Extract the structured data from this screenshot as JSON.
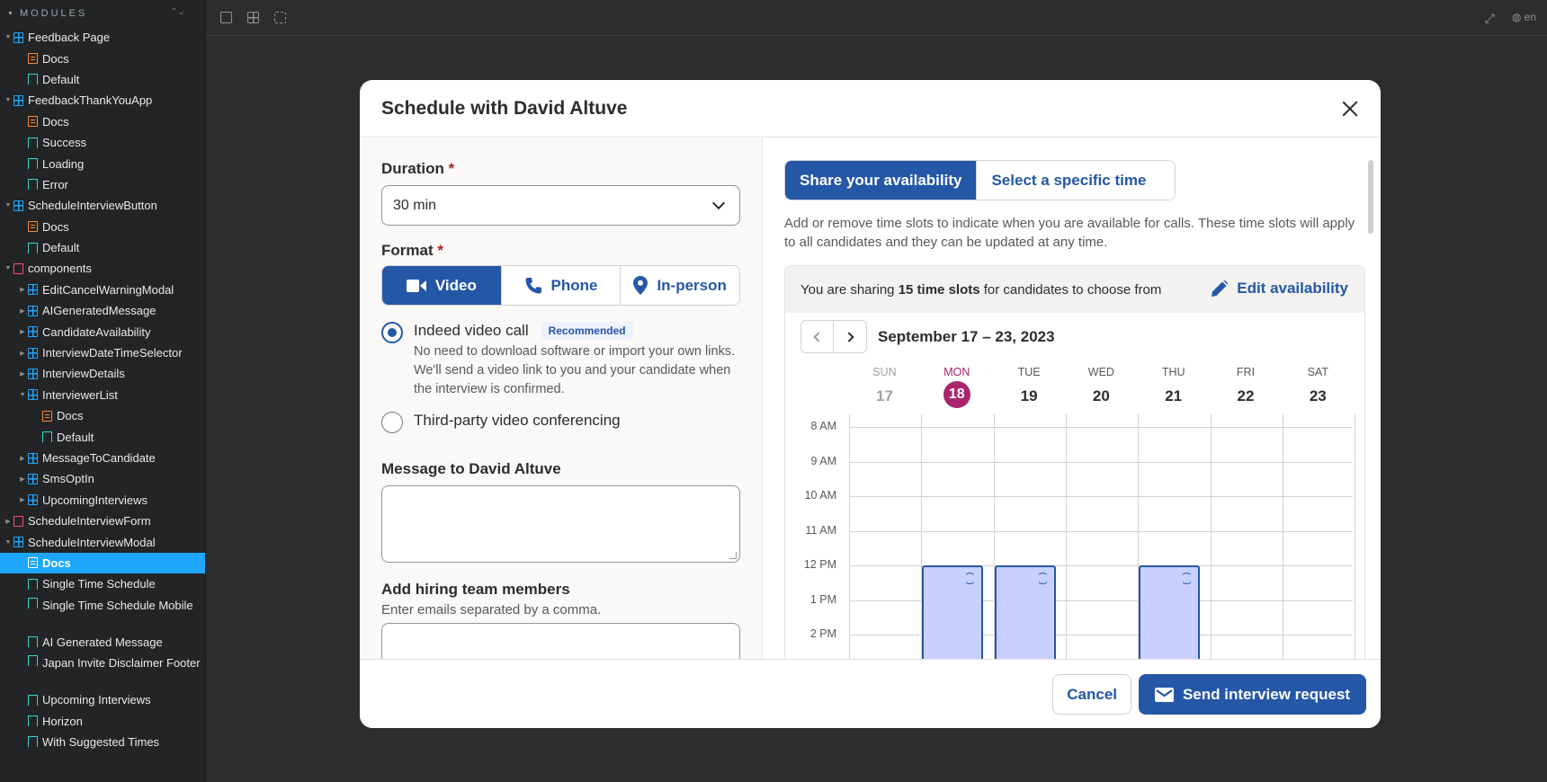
{
  "sidebar": {
    "header": "MODULES",
    "items": [
      {
        "label": "Feedback Page",
        "type": "component",
        "depth": 0,
        "expanded": true
      },
      {
        "label": "Docs",
        "type": "doc",
        "depth": 1
      },
      {
        "label": "Default",
        "type": "story",
        "depth": 1
      },
      {
        "label": "FeedbackThankYouApp",
        "type": "component",
        "depth": 0,
        "expanded": true
      },
      {
        "label": "Docs",
        "type": "doc",
        "depth": 1
      },
      {
        "label": "Success",
        "type": "story",
        "depth": 1
      },
      {
        "label": "Loading",
        "type": "story",
        "depth": 1
      },
      {
        "label": "Error",
        "type": "story",
        "depth": 1
      },
      {
        "label": "ScheduleInterviewButton",
        "type": "component",
        "depth": 0,
        "expanded": true
      },
      {
        "label": "Docs",
        "type": "doc",
        "depth": 1
      },
      {
        "label": "Default",
        "type": "story",
        "depth": 1
      },
      {
        "label": "components",
        "type": "folder",
        "depth": 0,
        "expanded": true
      },
      {
        "label": "EditCancelWarningModal",
        "type": "component",
        "depth": 1,
        "collapsed": true
      },
      {
        "label": "AIGeneratedMessage",
        "type": "component",
        "depth": 1,
        "collapsed": true
      },
      {
        "label": "CandidateAvailability",
        "type": "component",
        "depth": 1,
        "collapsed": true
      },
      {
        "label": "InterviewDateTimeSelector",
        "type": "component",
        "depth": 1,
        "collapsed": true
      },
      {
        "label": "InterviewDetails",
        "type": "component",
        "depth": 1,
        "collapsed": true
      },
      {
        "label": "InterviewerList",
        "type": "component",
        "depth": 1,
        "expanded": true
      },
      {
        "label": "Docs",
        "type": "doc",
        "depth": 2
      },
      {
        "label": "Default",
        "type": "story",
        "depth": 2
      },
      {
        "label": "MessageToCandidate",
        "type": "component",
        "depth": 1,
        "collapsed": true
      },
      {
        "label": "SmsOptIn",
        "type": "component",
        "depth": 1,
        "collapsed": true
      },
      {
        "label": "UpcomingInterviews",
        "type": "component",
        "depth": 1,
        "collapsed": true
      },
      {
        "label": "ScheduleInterviewForm",
        "type": "folder",
        "depth": 0,
        "collapsed": true
      },
      {
        "label": "ScheduleInterviewModal",
        "type": "component",
        "depth": 0,
        "expanded": true
      },
      {
        "label": "Docs",
        "type": "doc",
        "depth": 1,
        "active": true
      },
      {
        "label": "Single Time Schedule",
        "type": "story",
        "depth": 1
      },
      {
        "label": "Single Time Schedule Mobile",
        "type": "story",
        "depth": 1,
        "tall": true
      },
      {
        "label": "AI Generated Message",
        "type": "story",
        "depth": 1
      },
      {
        "label": "Japan Invite Disclaimer Footer",
        "type": "story",
        "depth": 1,
        "tall": true
      },
      {
        "label": "Upcoming Interviews",
        "type": "story",
        "depth": 1
      },
      {
        "label": "Horizon",
        "type": "story",
        "depth": 1
      },
      {
        "label": "With Suggested Times",
        "type": "story",
        "depth": 1
      }
    ]
  },
  "toolbar": {
    "icons": [
      "image-icon",
      "grid-icon",
      "outline-icon"
    ],
    "locale": "en"
  },
  "modal": {
    "title": "Schedule with David Altuve",
    "duration": {
      "label": "Duration",
      "required_mark": "*",
      "value": "30 min"
    },
    "format": {
      "label": "Format",
      "required_mark": "*",
      "options": [
        {
          "label": "Video",
          "icon": "video-icon",
          "selected": true
        },
        {
          "label": "Phone",
          "icon": "phone-icon",
          "selected": false
        },
        {
          "label": "In-person",
          "icon": "location-pin-icon",
          "selected": false
        }
      ]
    },
    "video_options": [
      {
        "title": "Indeed video call",
        "badge": "Recommended",
        "selected": true,
        "desc": "No need to download software or import your own links. We'll send a video link to you and your candidate when the interview is confirmed."
      },
      {
        "title": "Third-party video conferencing",
        "selected": false
      }
    ],
    "message": {
      "label": "Message to David Altuve",
      "value": ""
    },
    "hiring_team": {
      "label": "Add hiring team members",
      "hint": "Enter emails separated by a comma.",
      "value": ""
    },
    "tabs": [
      {
        "label": "Share your availability",
        "selected": true
      },
      {
        "label": "Select a specific time",
        "selected": false
      }
    ],
    "info": "Add or remove time slots to indicate when you are available for calls. These time slots will apply to all candidates and they can be updated at any time.",
    "sharing": {
      "prefix": "You are sharing ",
      "count": "15 time slots",
      "suffix": " for candidates to choose from"
    },
    "edit_label": "Edit availability",
    "week_label": "September 17 – 23, 2023",
    "days": [
      {
        "name": "SUN",
        "num": "17",
        "state": "past"
      },
      {
        "name": "MON",
        "num": "18",
        "state": "today"
      },
      {
        "name": "TUE",
        "num": "19",
        "state": ""
      },
      {
        "name": "WED",
        "num": "20",
        "state": ""
      },
      {
        "name": "THU",
        "num": "21",
        "state": ""
      },
      {
        "name": "FRI",
        "num": "22",
        "state": ""
      },
      {
        "name": "SAT",
        "num": "23",
        "state": ""
      }
    ],
    "times": [
      "8 AM",
      "9 AM",
      "10 AM",
      "11 AM",
      "12 PM",
      "1 PM",
      "2 PM"
    ],
    "available_blocks": [
      {
        "day": "MON",
        "start": "12 PM"
      },
      {
        "day": "TUE",
        "start": "12 PM"
      },
      {
        "day": "THU",
        "start": "12 PM"
      }
    ],
    "cancel_label": "Cancel",
    "send_label": "Send interview request"
  },
  "colors": {
    "accent": "#2557a7",
    "today": "#a9256d",
    "slot_fill": "#c8d0ff",
    "sidebar_active": "#1ea7fd"
  }
}
